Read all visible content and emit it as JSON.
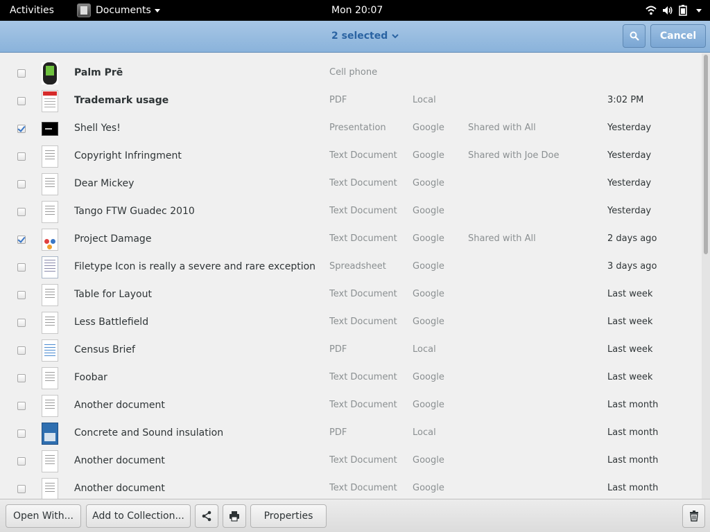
{
  "topbar": {
    "activities": "Activities",
    "app_name": "Documents",
    "clock": "Mon 20:07",
    "icons": [
      "wifi-icon",
      "volume-icon",
      "battery-icon"
    ]
  },
  "header": {
    "selection_label": "2 selected",
    "cancel_label": "Cancel",
    "search_icon": "search-icon"
  },
  "documents": [
    {
      "name": "Palm Prē",
      "bold": true,
      "type": "Cell phone",
      "source": "",
      "shared": "",
      "date": "",
      "checked": false,
      "thumb": "phone"
    },
    {
      "name": "Trademark usage",
      "bold": true,
      "type": "PDF",
      "source": "Local",
      "shared": "",
      "date": "3:02 PM",
      "checked": false,
      "thumb": "pdf"
    },
    {
      "name": "Shell Yes!",
      "bold": false,
      "type": "Presentation",
      "source": "Google",
      "shared": "Shared with All",
      "date": "Yesterday",
      "checked": true,
      "thumb": "pres"
    },
    {
      "name": "Copyright Infringment",
      "bold": false,
      "type": "Text Document",
      "source": "Google",
      "shared": "Shared with Joe Doe",
      "date": "Yesterday",
      "checked": false,
      "thumb": "doc"
    },
    {
      "name": "Dear Mickey",
      "bold": false,
      "type": "Text Document",
      "source": "Google",
      "shared": "",
      "date": "Yesterday",
      "checked": false,
      "thumb": "doc"
    },
    {
      "name": "Tango FTW Guadec 2010",
      "bold": false,
      "type": "Text Document",
      "source": "Google",
      "shared": "",
      "date": "Yesterday",
      "checked": false,
      "thumb": "doc"
    },
    {
      "name": "Project Damage",
      "bold": false,
      "type": "Text Document",
      "source": "Google",
      "shared": "Shared with All",
      "date": "2 days ago",
      "checked": true,
      "thumb": "dmg"
    },
    {
      "name": "Filetype Icon is really a severe and rare exception",
      "bold": false,
      "type": "Spreadsheet",
      "source": "Google",
      "shared": "",
      "date": "3 days ago",
      "checked": false,
      "thumb": "sheet"
    },
    {
      "name": "Table for Layout",
      "bold": false,
      "type": "Text Document",
      "source": "Google",
      "shared": "",
      "date": "Last week",
      "checked": false,
      "thumb": "doc"
    },
    {
      "name": "Less Battlefield",
      "bold": false,
      "type": "Text Document",
      "source": "Google",
      "shared": "",
      "date": "Last week",
      "checked": false,
      "thumb": "doc"
    },
    {
      "name": "Census Brief",
      "bold": false,
      "type": "PDF",
      "source": "Local",
      "shared": "",
      "date": "Last week",
      "checked": false,
      "thumb": "census"
    },
    {
      "name": "Foobar",
      "bold": false,
      "type": "Text Document",
      "source": "Google",
      "shared": "",
      "date": "Last week",
      "checked": false,
      "thumb": "doc"
    },
    {
      "name": "Another document",
      "bold": false,
      "type": "Text Document",
      "source": "Google",
      "shared": "",
      "date": "Last month",
      "checked": false,
      "thumb": "doc"
    },
    {
      "name": "Concrete and Sound insulation",
      "bold": false,
      "type": "PDF",
      "source": "Local",
      "shared": "",
      "date": "Last month",
      "checked": false,
      "thumb": "concrete"
    },
    {
      "name": "Another document",
      "bold": false,
      "type": "Text Document",
      "source": "Google",
      "shared": "",
      "date": "Last month",
      "checked": false,
      "thumb": "doc"
    },
    {
      "name": "Another document",
      "bold": false,
      "type": "Text Document",
      "source": "Google",
      "shared": "",
      "date": "Last month",
      "checked": false,
      "thumb": "doc"
    }
  ],
  "actionbar": {
    "open_with_label": "Open With...",
    "add_to_collection_label": "Add to Collection...",
    "share_icon": "share-icon",
    "print_icon": "print-icon",
    "properties_label": "Properties",
    "trash_icon": "trash-icon"
  },
  "colors": {
    "header_accent": "#8ab3db",
    "selection_text": "#2a63a2",
    "check_mark": "#3a77c6"
  }
}
